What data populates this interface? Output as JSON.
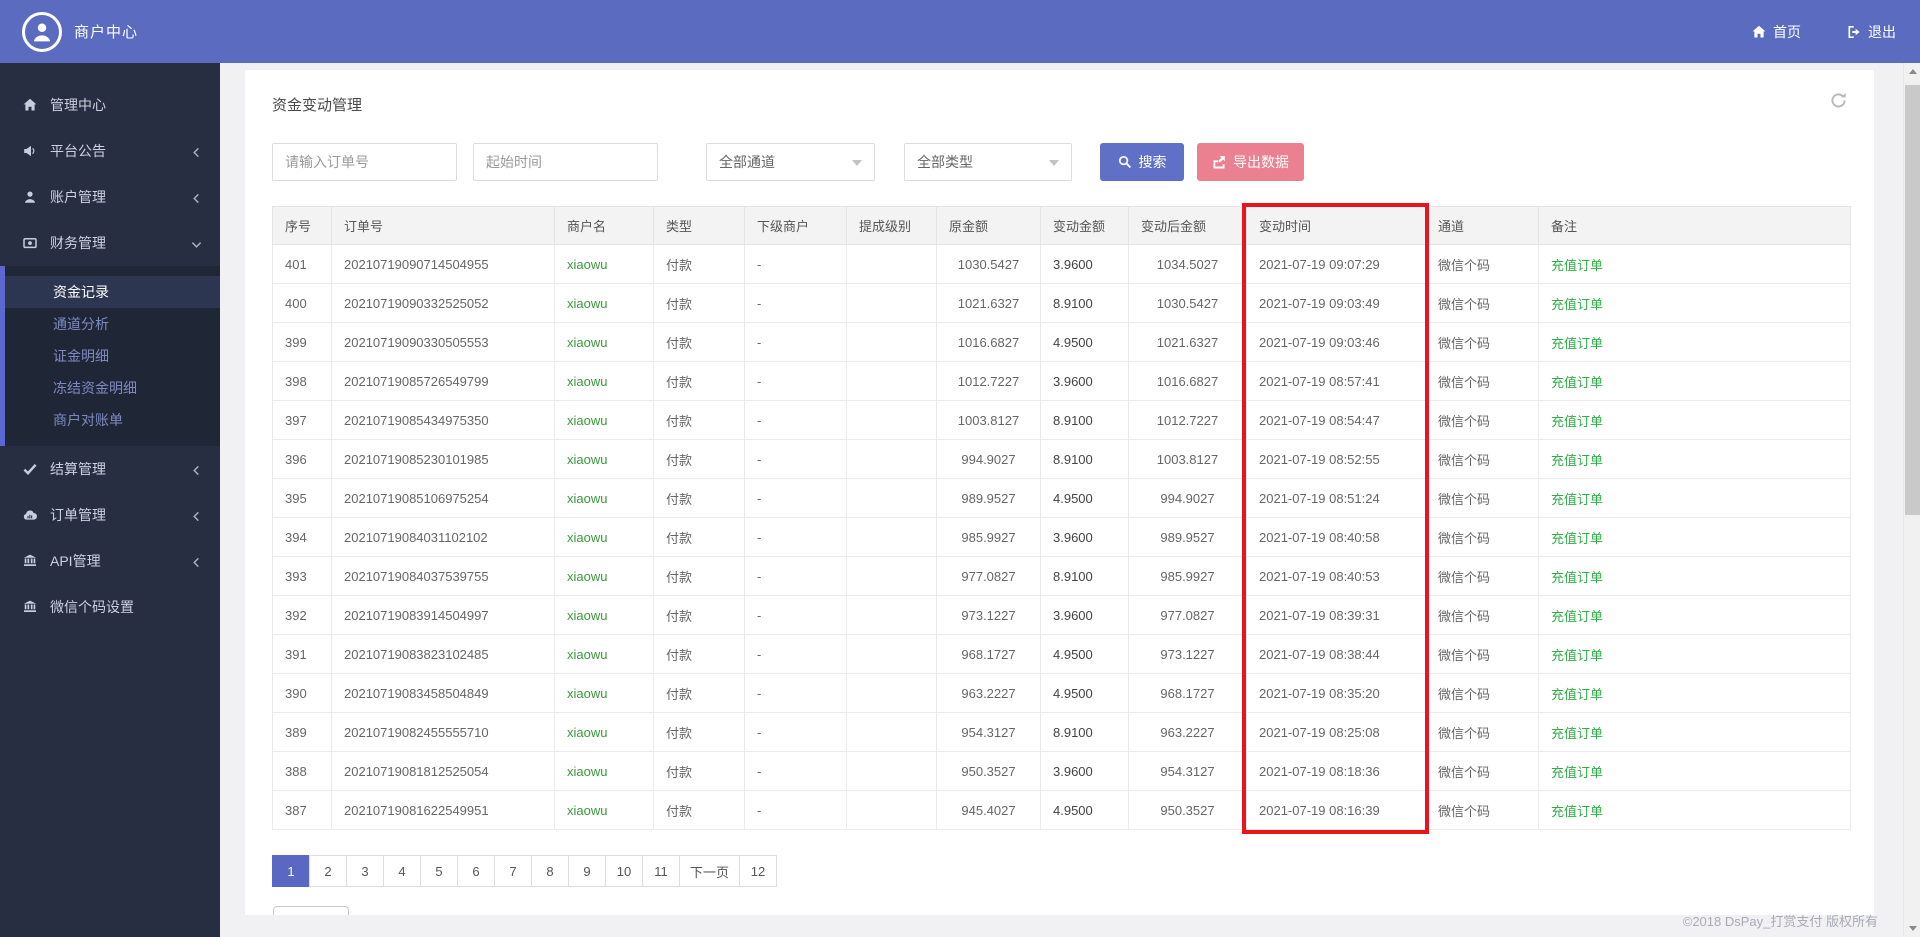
{
  "topbar": {
    "brand": "商户中心",
    "home": "首页",
    "logout": "退出"
  },
  "sidebar": {
    "items": [
      {
        "label": "管理中心",
        "icon": "home-icon",
        "chevron": ""
      },
      {
        "label": "平台公告",
        "icon": "bullhorn-icon",
        "chevron": "left"
      },
      {
        "label": "账户管理",
        "icon": "user-icon",
        "chevron": "left"
      },
      {
        "label": "财务管理",
        "icon": "money-icon",
        "chevron": "down",
        "expanded": true,
        "children": [
          "资金记录",
          "通道分析",
          "证金明细",
          "冻结资金明细",
          "商户对账单"
        ],
        "active_child": "资金记录"
      },
      {
        "label": "结算管理",
        "icon": "check-icon",
        "chevron": "left"
      },
      {
        "label": "订单管理",
        "icon": "cloud-icon",
        "chevron": "left"
      },
      {
        "label": "API管理",
        "icon": "bank-icon",
        "chevron": "left"
      },
      {
        "label": "微信个码设置",
        "icon": "bank-icon",
        "chevron": ""
      }
    ]
  },
  "page": {
    "title": "资金变动管理",
    "filters": {
      "order_input_placeholder": "请输入订单号",
      "start_time_placeholder": "起始时间",
      "channel_selected": "全部通道",
      "type_selected": "全部类型",
      "search_button": "搜索",
      "export_button": "导出数据"
    },
    "table": {
      "headers": [
        "序号",
        "订单号",
        "商户名",
        "类型",
        "下级商户",
        "提成级别",
        "原金额",
        "变动金额",
        "变动后金额",
        "变动时间",
        "通道",
        "备注"
      ],
      "column_keys": [
        "index",
        "order-no",
        "merchant",
        "type",
        "sub-merchant",
        "commission-level",
        "original-amount",
        "change-amount",
        "after-amount",
        "change-time",
        "channel",
        "remark"
      ],
      "rows": [
        [
          "401",
          "20210719090714504955",
          "xiaowu",
          "付款",
          "-",
          "",
          "1030.5427",
          "3.9600",
          "1034.5027",
          "2021-07-19 09:07:29",
          "微信个码",
          "充值订单"
        ],
        [
          "400",
          "20210719090332525052",
          "xiaowu",
          "付款",
          "-",
          "",
          "1021.6327",
          "8.9100",
          "1030.5427",
          "2021-07-19 09:03:49",
          "微信个码",
          "充值订单"
        ],
        [
          "399",
          "20210719090330505553",
          "xiaowu",
          "付款",
          "-",
          "",
          "1016.6827",
          "4.9500",
          "1021.6327",
          "2021-07-19 09:03:46",
          "微信个码",
          "充值订单"
        ],
        [
          "398",
          "20210719085726549799",
          "xiaowu",
          "付款",
          "-",
          "",
          "1012.7227",
          "3.9600",
          "1016.6827",
          "2021-07-19 08:57:41",
          "微信个码",
          "充值订单"
        ],
        [
          "397",
          "20210719085434975350",
          "xiaowu",
          "付款",
          "-",
          "",
          "1003.8127",
          "8.9100",
          "1012.7227",
          "2021-07-19 08:54:47",
          "微信个码",
          "充值订单"
        ],
        [
          "396",
          "20210719085230101985",
          "xiaowu",
          "付款",
          "-",
          "",
          "994.9027",
          "8.9100",
          "1003.8127",
          "2021-07-19 08:52:55",
          "微信个码",
          "充值订单"
        ],
        [
          "395",
          "20210719085106975254",
          "xiaowu",
          "付款",
          "-",
          "",
          "989.9527",
          "4.9500",
          "994.9027",
          "2021-07-19 08:51:24",
          "微信个码",
          "充值订单"
        ],
        [
          "394",
          "20210719084031102102",
          "xiaowu",
          "付款",
          "-",
          "",
          "985.9927",
          "3.9600",
          "989.9527",
          "2021-07-19 08:40:58",
          "微信个码",
          "充值订单"
        ],
        [
          "393",
          "20210719084037539755",
          "xiaowu",
          "付款",
          "-",
          "",
          "977.0827",
          "8.9100",
          "985.9927",
          "2021-07-19 08:40:53",
          "微信个码",
          "充值订单"
        ],
        [
          "392",
          "20210719083914504997",
          "xiaowu",
          "付款",
          "-",
          "",
          "973.1227",
          "3.9600",
          "977.0827",
          "2021-07-19 08:39:31",
          "微信个码",
          "充值订单"
        ],
        [
          "391",
          "20210719083823102485",
          "xiaowu",
          "付款",
          "-",
          "",
          "968.1727",
          "4.9500",
          "973.1227",
          "2021-07-19 08:38:44",
          "微信个码",
          "充值订单"
        ],
        [
          "390",
          "20210719083458504849",
          "xiaowu",
          "付款",
          "-",
          "",
          "963.2227",
          "4.9500",
          "968.1727",
          "2021-07-19 08:35:20",
          "微信个码",
          "充值订单"
        ],
        [
          "389",
          "20210719082455555710",
          "xiaowu",
          "付款",
          "-",
          "",
          "954.3127",
          "8.9100",
          "963.2227",
          "2021-07-19 08:25:08",
          "微信个码",
          "充值订单"
        ],
        [
          "388",
          "20210719081812525054",
          "xiaowu",
          "付款",
          "-",
          "",
          "950.3527",
          "3.9600",
          "954.3127",
          "2021-07-19 08:18:36",
          "微信个码",
          "充值订单"
        ],
        [
          "387",
          "20210719081622549951",
          "xiaowu",
          "付款",
          "-",
          "",
          "945.4027",
          "4.9500",
          "950.3527",
          "2021-07-19 08:16:39",
          "微信个码",
          "充值订单"
        ]
      ],
      "highlighted_column": "变动时间"
    },
    "pagination": {
      "pages": [
        "1",
        "2",
        "3",
        "4",
        "5",
        "6",
        "7",
        "8",
        "9",
        "10",
        "11",
        "下一页",
        "12"
      ],
      "active": "1"
    }
  },
  "footer": {
    "copyright": "©2018 DsPay_打赏支付 版权所有"
  },
  "colors": {
    "topbar_blue": "#5b6cc0",
    "sidebar_dark": "#272e42",
    "accent_blue": "#5f70c6",
    "export_pink": "#ea8090",
    "merchant_green": "#3a9a3a",
    "remark_green": "#2fae46",
    "highlight_red": "#e8141f"
  }
}
